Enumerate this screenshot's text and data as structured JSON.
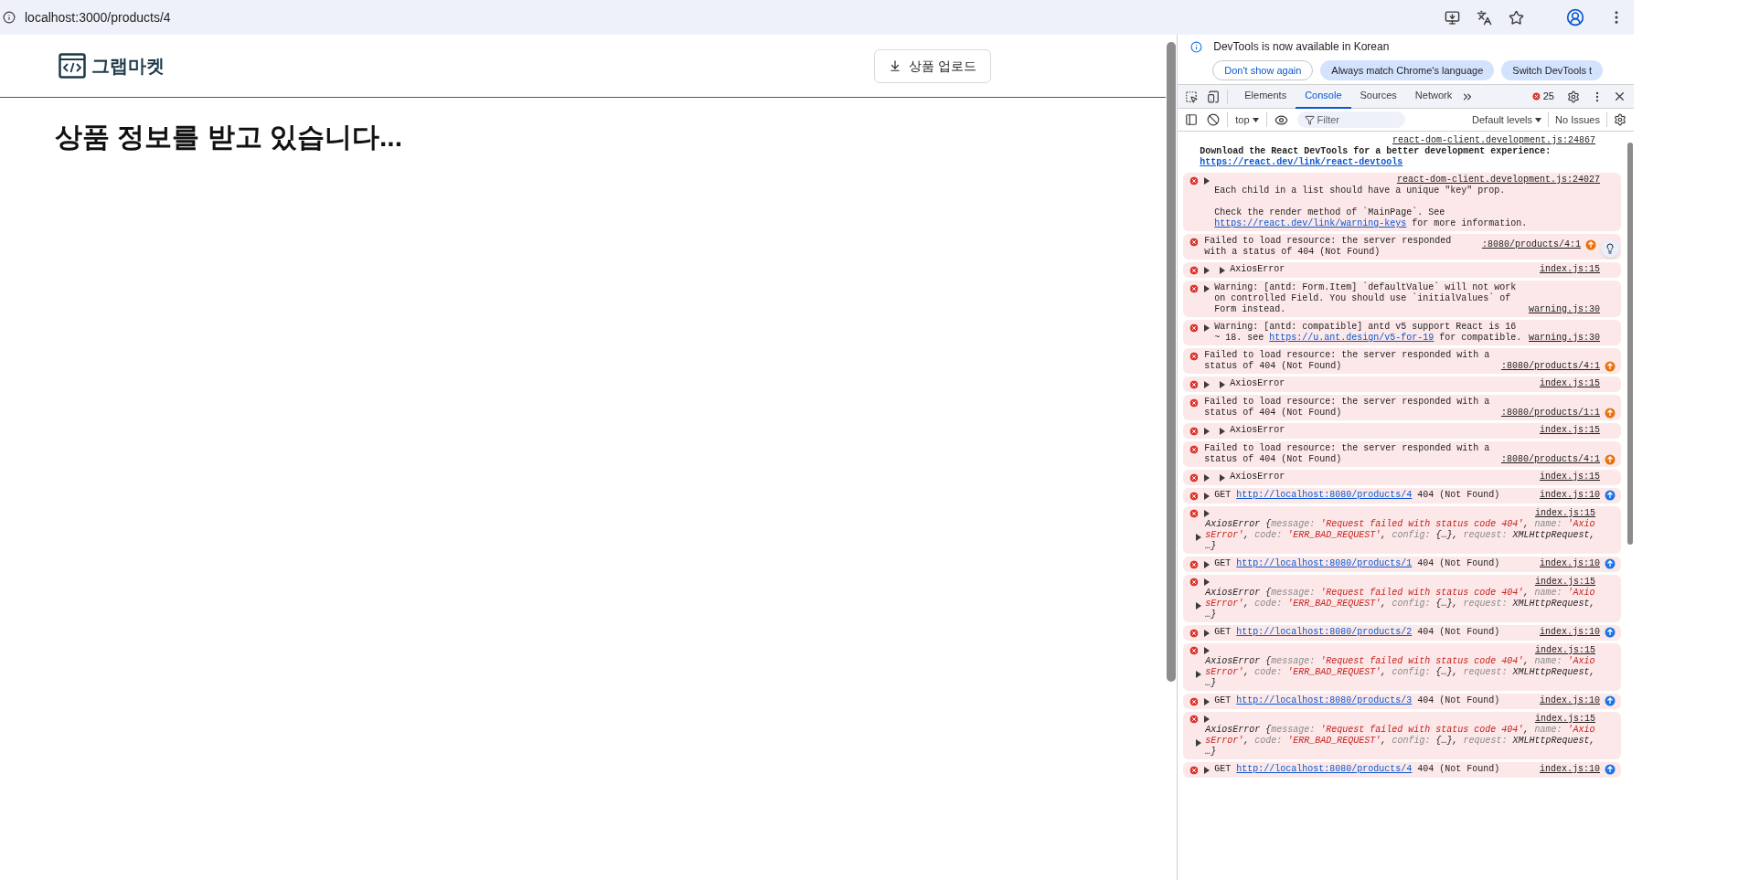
{
  "browser": {
    "url": "localhost:3000/products/4"
  },
  "page": {
    "logo_text": "그랩마켓",
    "upload_button": "상품 업로드",
    "heading": "상품 정보를 받고 있습니다..."
  },
  "devtools": {
    "infobar": {
      "message": "DevTools is now available in Korean",
      "buttons": [
        {
          "label": "Don't show again",
          "kind": "outline"
        },
        {
          "label": "Always match Chrome's language",
          "kind": "filled"
        },
        {
          "label": "Switch DevTools t",
          "kind": "filled"
        }
      ]
    },
    "tabs": [
      {
        "label": "Elements",
        "selected": false
      },
      {
        "label": "Console",
        "selected": true
      },
      {
        "label": "Sources",
        "selected": false
      },
      {
        "label": "Network",
        "selected": false
      }
    ],
    "error_count": "25",
    "toolbar": {
      "context": "top",
      "filter_placeholder": "Filter",
      "levels": "Default levels",
      "issues": "No Issues"
    },
    "messages": [
      {
        "kind": "log",
        "source": "react-dom-client.development.js:24867",
        "segments": [
          {
            "t": "Download the React DevTools for a better development experience: ",
            "kind": "bold"
          },
          {
            "t": "https://react.dev/link/react-devtools",
            "kind": "bold_link"
          }
        ]
      },
      {
        "kind": "error",
        "expandable": true,
        "source": "react-dom-client.development.js:24027",
        "segments": [
          {
            "t": "Each child in a list should have a unique \"key\" prop.\n\nCheck the render method of `MainPage`. See ",
            "kind": "plain"
          },
          {
            "t": "https://react.dev/link/warning-keys",
            "kind": "link"
          },
          {
            "t": " for more information.",
            "kind": "plain"
          }
        ]
      },
      {
        "kind": "error",
        "source": ":8080/products/4:1",
        "network_icon": {
          "color": "#e8710a"
        },
        "insight": true,
        "segments": [
          {
            "t": "Failed to load resource: the server responded with a status of 404 (Not Found)",
            "kind": "plain"
          }
        ]
      },
      {
        "kind": "error",
        "expandable": true,
        "nested_toggle": true,
        "source": "index.js:15",
        "segments": [
          {
            "t": "AxiosError",
            "kind": "plain"
          }
        ]
      },
      {
        "kind": "error",
        "expandable": true,
        "source": "warning.js:30",
        "segments": [
          {
            "t": "Warning: [antd: Form.Item] `defaultValue` will not work on controlled Field. You should use `initialValues` of Form instead.",
            "kind": "plain"
          }
        ]
      },
      {
        "kind": "error",
        "expandable": true,
        "source": "warning.js:30",
        "segments": [
          {
            "t": "Warning: [antd: compatible] antd v5 support React is 16 ~ 18. see ",
            "kind": "plain"
          },
          {
            "t": "https://u.ant.design/v5-for-19",
            "kind": "link"
          },
          {
            "t": " for compatible.",
            "kind": "plain"
          }
        ]
      },
      {
        "kind": "error",
        "source": ":8080/products/4:1",
        "network_icon": {
          "color": "#e8710a"
        },
        "segments": [
          {
            "t": "Failed to load resource: the server responded with a status of 404 (Not Found)",
            "kind": "plain"
          }
        ]
      },
      {
        "kind": "error",
        "expandable": true,
        "nested_toggle": true,
        "source": "index.js:15",
        "segments": [
          {
            "t": "AxiosError",
            "kind": "plain"
          }
        ]
      },
      {
        "kind": "error",
        "source": ":8080/products/1:1",
        "network_icon": {
          "color": "#e8710a"
        },
        "segments": [
          {
            "t": "Failed to load resource: the server responded with a status of 404 (Not Found)",
            "kind": "plain"
          }
        ]
      },
      {
        "kind": "error",
        "expandable": true,
        "nested_toggle": true,
        "source": "index.js:15",
        "segments": [
          {
            "t": "AxiosError",
            "kind": "plain"
          }
        ]
      },
      {
        "kind": "error",
        "source": ":8080/products/4:1",
        "network_icon": {
          "color": "#e8710a"
        },
        "segments": [
          {
            "t": "Failed to load resource: the server responded with a status of 404 (Not Found)",
            "kind": "plain"
          }
        ]
      },
      {
        "kind": "error",
        "expandable": true,
        "nested_toggle": true,
        "source": "index.js:15",
        "segments": [
          {
            "t": "AxiosError",
            "kind": "plain"
          }
        ]
      },
      {
        "kind": "error",
        "expandable": true,
        "source": "index.js:10",
        "network_icon": {
          "color": "#1a73e8"
        },
        "segments": [
          {
            "t": "GET ",
            "kind": "plain"
          },
          {
            "t": "http://localhost:8080/products/4",
            "kind": "link"
          },
          {
            "t": " 404 (Not Found)",
            "kind": "plain"
          }
        ]
      },
      {
        "kind": "object",
        "expandable": true,
        "source": "index.js:15",
        "segments": [
          {
            "t": "AxiosError {",
            "kind": "plain"
          },
          {
            "t": "message: ",
            "kind": "key"
          },
          {
            "t": "'Request failed with status code 404'",
            "kind": "string"
          },
          {
            "t": ", ",
            "kind": "plain"
          },
          {
            "t": "name: ",
            "kind": "key"
          },
          {
            "t": "'AxiosError'",
            "kind": "string"
          },
          {
            "t": ", ",
            "kind": "plain"
          },
          {
            "t": "code: ",
            "kind": "key"
          },
          {
            "t": "'ERR_BAD_REQUEST'",
            "kind": "string"
          },
          {
            "t": ", ",
            "kind": "plain"
          },
          {
            "t": "config: ",
            "kind": "key"
          },
          {
            "t": "{…}, ",
            "kind": "plain"
          },
          {
            "t": "request: ",
            "kind": "key"
          },
          {
            "t": "XMLHttpRequest, …}",
            "kind": "plain"
          }
        ]
      },
      {
        "kind": "error",
        "expandable": true,
        "source": "index.js:10",
        "network_icon": {
          "color": "#1a73e8"
        },
        "segments": [
          {
            "t": "GET ",
            "kind": "plain"
          },
          {
            "t": "http://localhost:8080/products/1",
            "kind": "link"
          },
          {
            "t": " 404 (Not Found)",
            "kind": "plain"
          }
        ]
      },
      {
        "kind": "object",
        "expandable": true,
        "source": "index.js:15",
        "segments": [
          {
            "t": "AxiosError {",
            "kind": "plain"
          },
          {
            "t": "message: ",
            "kind": "key"
          },
          {
            "t": "'Request failed with status code 404'",
            "kind": "string"
          },
          {
            "t": ", ",
            "kind": "plain"
          },
          {
            "t": "name: ",
            "kind": "key"
          },
          {
            "t": "'AxiosError'",
            "kind": "string"
          },
          {
            "t": ", ",
            "kind": "plain"
          },
          {
            "t": "code: ",
            "kind": "key"
          },
          {
            "t": "'ERR_BAD_REQUEST'",
            "kind": "string"
          },
          {
            "t": ", ",
            "kind": "plain"
          },
          {
            "t": "config: ",
            "kind": "key"
          },
          {
            "t": "{…}, ",
            "kind": "plain"
          },
          {
            "t": "request: ",
            "kind": "key"
          },
          {
            "t": "XMLHttpRequest, …}",
            "kind": "plain"
          }
        ]
      },
      {
        "kind": "error",
        "expandable": true,
        "source": "index.js:10",
        "network_icon": {
          "color": "#1a73e8"
        },
        "segments": [
          {
            "t": "GET ",
            "kind": "plain"
          },
          {
            "t": "http://localhost:8080/products/2",
            "kind": "link"
          },
          {
            "t": " 404 (Not Found)",
            "kind": "plain"
          }
        ]
      },
      {
        "kind": "object",
        "expandable": true,
        "source": "index.js:15",
        "segments": [
          {
            "t": "AxiosError {",
            "kind": "plain"
          },
          {
            "t": "message: ",
            "kind": "key"
          },
          {
            "t": "'Request failed with status code 404'",
            "kind": "string"
          },
          {
            "t": ", ",
            "kind": "plain"
          },
          {
            "t": "name: ",
            "kind": "key"
          },
          {
            "t": "'AxiosError'",
            "kind": "string"
          },
          {
            "t": ", ",
            "kind": "plain"
          },
          {
            "t": "code: ",
            "kind": "key"
          },
          {
            "t": "'ERR_BAD_REQUEST'",
            "kind": "string"
          },
          {
            "t": ", ",
            "kind": "plain"
          },
          {
            "t": "config: ",
            "kind": "key"
          },
          {
            "t": "{…}, ",
            "kind": "plain"
          },
          {
            "t": "request: ",
            "kind": "key"
          },
          {
            "t": "XMLHttpRequest, …}",
            "kind": "plain"
          }
        ]
      },
      {
        "kind": "error",
        "expandable": true,
        "source": "index.js:10",
        "network_icon": {
          "color": "#1a73e8"
        },
        "segments": [
          {
            "t": "GET ",
            "kind": "plain"
          },
          {
            "t": "http://localhost:8080/products/3",
            "kind": "link"
          },
          {
            "t": " 404 (Not Found)",
            "kind": "plain"
          }
        ]
      },
      {
        "kind": "object",
        "expandable": true,
        "source": "index.js:15",
        "segments": [
          {
            "t": "AxiosError {",
            "kind": "plain"
          },
          {
            "t": "message: ",
            "kind": "key"
          },
          {
            "t": "'Request failed with status code 404'",
            "kind": "string"
          },
          {
            "t": ", ",
            "kind": "plain"
          },
          {
            "t": "name: ",
            "kind": "key"
          },
          {
            "t": "'AxiosError'",
            "kind": "string"
          },
          {
            "t": ", ",
            "kind": "plain"
          },
          {
            "t": "code: ",
            "kind": "key"
          },
          {
            "t": "'ERR_BAD_REQUEST'",
            "kind": "string"
          },
          {
            "t": ", ",
            "kind": "plain"
          },
          {
            "t": "config: ",
            "kind": "key"
          },
          {
            "t": "{…}, ",
            "kind": "plain"
          },
          {
            "t": "request: ",
            "kind": "key"
          },
          {
            "t": "XMLHttpRequest, …}",
            "kind": "plain"
          }
        ]
      },
      {
        "kind": "error",
        "expandable": true,
        "source": "index.js:10",
        "network_icon": {
          "color": "#1a73e8"
        },
        "segments": [
          {
            "t": "GET ",
            "kind": "plain"
          },
          {
            "t": "http://localhost:8080/products/4",
            "kind": "link"
          },
          {
            "t": " 404 (Not Found)",
            "kind": "plain"
          }
        ]
      }
    ]
  }
}
